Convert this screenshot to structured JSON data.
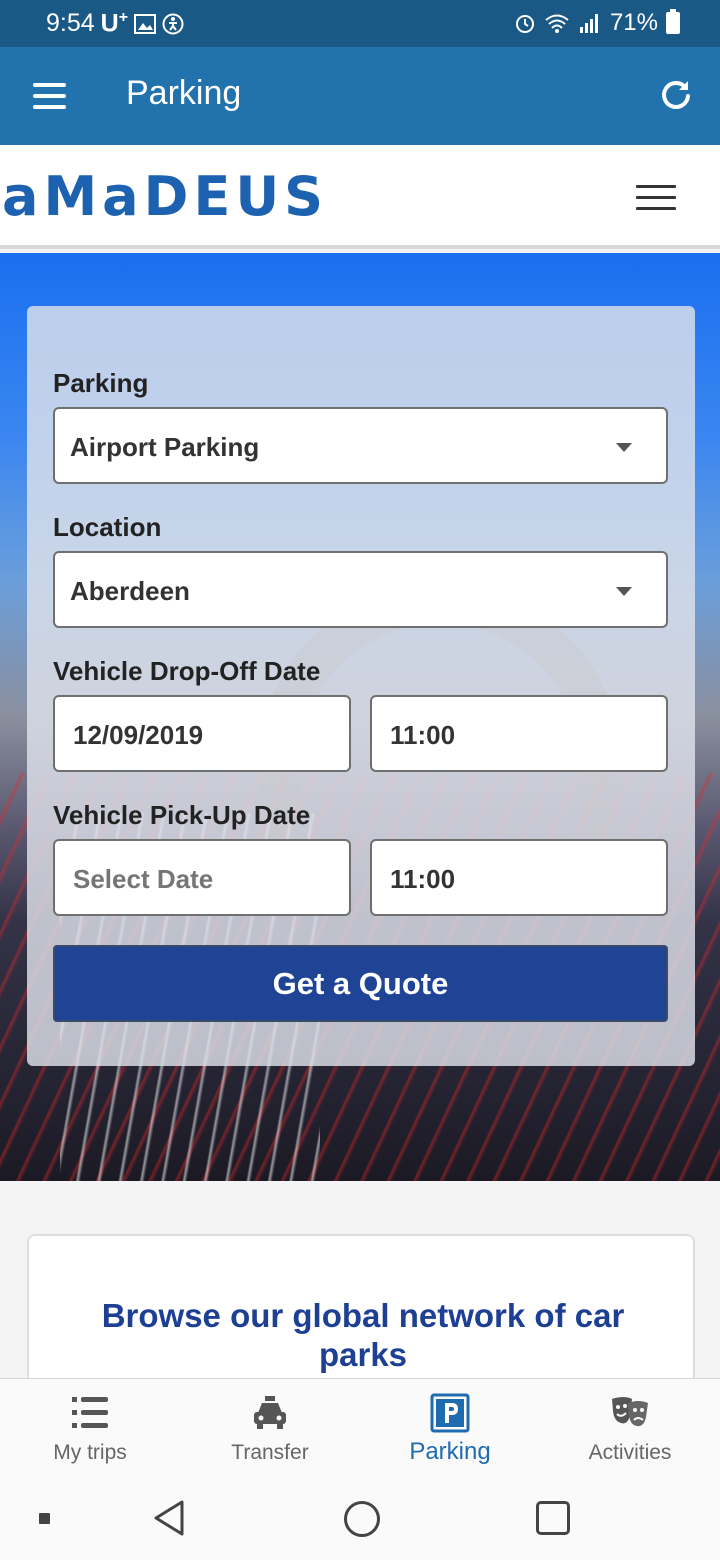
{
  "status_bar": {
    "time": "9:54",
    "carrier": "U",
    "battery": "71%"
  },
  "app_bar": {
    "title": "Parking"
  },
  "site": {
    "logo": "aMaDEUS"
  },
  "form": {
    "parking_label": "Parking",
    "parking_value": "Airport Parking",
    "location_label": "Location",
    "location_value": "Aberdeen",
    "dropoff_label": "Vehicle Drop-Off Date",
    "dropoff_date": "12/09/2019",
    "dropoff_time": "11:00",
    "pickup_label": "Vehicle Pick-Up Date",
    "pickup_date_placeholder": "Select Date",
    "pickup_time": "11:00",
    "submit_label": "Get a Quote"
  },
  "browse": {
    "heading": "Browse our global network of car parks"
  },
  "bottom_nav": {
    "items": [
      {
        "label": "My trips",
        "icon": "list-icon"
      },
      {
        "label": "Transfer",
        "icon": "taxi-icon"
      },
      {
        "label": "Parking",
        "icon": "parking-icon",
        "active": true
      },
      {
        "label": "Activities",
        "icon": "theater-masks-icon"
      }
    ]
  },
  "colors": {
    "status_bar": "#1a5886",
    "app_bar": "#2273ad",
    "logo": "#1d62b0",
    "button": "#1f4395",
    "active_nav": "#1e6bb0"
  }
}
